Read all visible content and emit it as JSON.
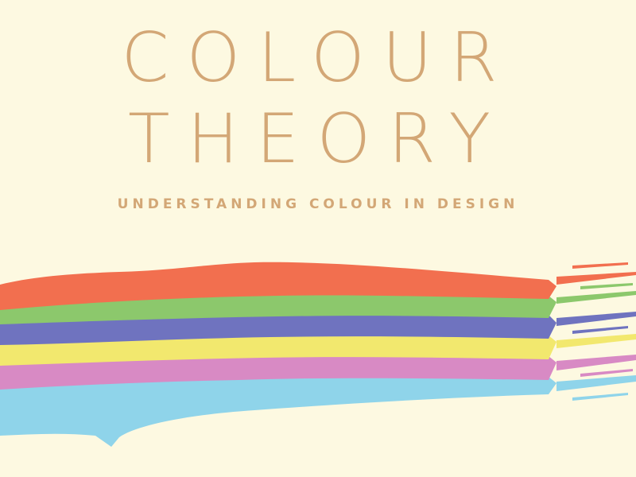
{
  "cover": {
    "title_line_1": "COLOUR",
    "title_line_2": "THEORY",
    "subtitle": "UNDERSTANDING COLOUR IN DESIGN"
  },
  "colors": {
    "background": "#fdf9e1",
    "text": "#d3a776",
    "stripes": [
      "#f26f4f",
      "#8cc86c",
      "#6f73bf",
      "#f2e86e",
      "#d88ac4",
      "#8fd4ea"
    ]
  }
}
